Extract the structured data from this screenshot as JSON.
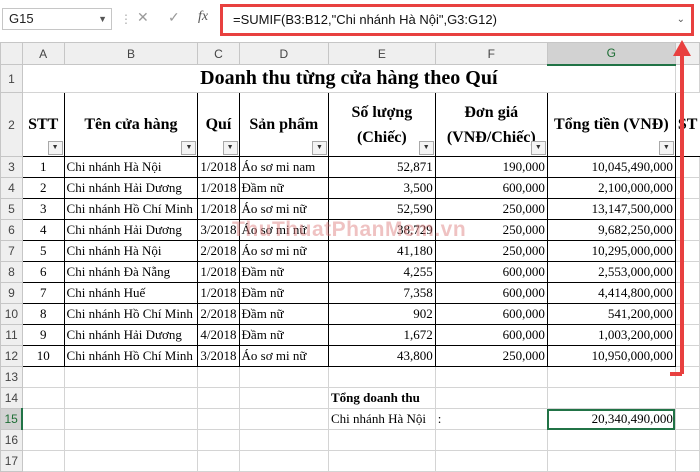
{
  "formula_bar": {
    "name_box": "G15",
    "cancel_icon": "✕",
    "enter_icon": "✓",
    "fx_icon": "fx",
    "formula": "=SUMIF(B3:B12,\"Chi nhánh Hà Nội\",G3:G12)"
  },
  "columns": [
    "A",
    "B",
    "C",
    "D",
    "E",
    "F",
    "G"
  ],
  "rows": [
    "1",
    "2",
    "3",
    "4",
    "5",
    "6",
    "7",
    "8",
    "9",
    "10",
    "11",
    "12",
    "13",
    "14",
    "15",
    "16",
    "17"
  ],
  "sheet": {
    "title": "Doanh thu từng cửa hàng theo Quí",
    "headers": {
      "stt": "STT",
      "store": "Tên cửa hàng",
      "quarter": "Quí",
      "product": "Sản phẩm",
      "qty": "Số lượng (Chiếc)",
      "price": "Đơn giá (VNĐ/Chiếc)",
      "total": "Tổng tiền (VNĐ)",
      "partial": "ST"
    },
    "data": [
      {
        "stt": "1",
        "store": "Chi nhánh Hà Nội",
        "quarter": "1/2018",
        "product": "Áo sơ mi nam",
        "qty": "52,871",
        "price": "190,000",
        "total": "10,045,490,000"
      },
      {
        "stt": "2",
        "store": "Chi nhánh Hải Dương",
        "quarter": "1/2018",
        "product": "Đầm nữ",
        "qty": "3,500",
        "price": "600,000",
        "total": "2,100,000,000"
      },
      {
        "stt": "3",
        "store": "Chi nhánh Hồ Chí Minh",
        "quarter": "1/2018",
        "product": "Áo sơ mi nữ",
        "qty": "52,590",
        "price": "250,000",
        "total": "13,147,500,000"
      },
      {
        "stt": "4",
        "store": "Chi nhánh Hải Dương",
        "quarter": "3/2018",
        "product": "Áo sơ mi nữ",
        "qty": "38,729",
        "price": "250,000",
        "total": "9,682,250,000"
      },
      {
        "stt": "5",
        "store": "Chi nhánh Hà Nội",
        "quarter": "2/2018",
        "product": "Áo sơ mi nữ",
        "qty": "41,180",
        "price": "250,000",
        "total": "10,295,000,000"
      },
      {
        "stt": "6",
        "store": "Chi nhánh Đà Nẵng",
        "quarter": "1/2018",
        "product": "Đầm nữ",
        "qty": "4,255",
        "price": "600,000",
        "total": "2,553,000,000"
      },
      {
        "stt": "7",
        "store": "Chi nhánh Huế",
        "quarter": "1/2018",
        "product": "Đầm nữ",
        "qty": "7,358",
        "price": "600,000",
        "total": "4,414,800,000"
      },
      {
        "stt": "8",
        "store": "Chi nhánh Hồ Chí Minh",
        "quarter": "2/2018",
        "product": "Đầm nữ",
        "qty": "902",
        "price": "600,000",
        "total": "541,200,000"
      },
      {
        "stt": "9",
        "store": "Chi nhánh Hải Dương",
        "quarter": "4/2018",
        "product": "Đầm nữ",
        "qty": "1,672",
        "price": "600,000",
        "total": "1,003,200,000"
      },
      {
        "stt": "10",
        "store": "Chi nhánh Hồ Chí Minh",
        "quarter": "3/2018",
        "product": "Áo sơ mi nữ",
        "qty": "43,800",
        "price": "250,000",
        "total": "10,950,000,000"
      }
    ],
    "summary_label": "Tổng doanh thu",
    "summary_branch": "Chi nhánh Hà Nội",
    "summary_colon": ":",
    "summary_value": "20,340,490,000"
  },
  "watermark": "ThuThuatPhanMem.vn",
  "colors": {
    "highlight": "#e8403f",
    "excel_green": "#217346"
  }
}
